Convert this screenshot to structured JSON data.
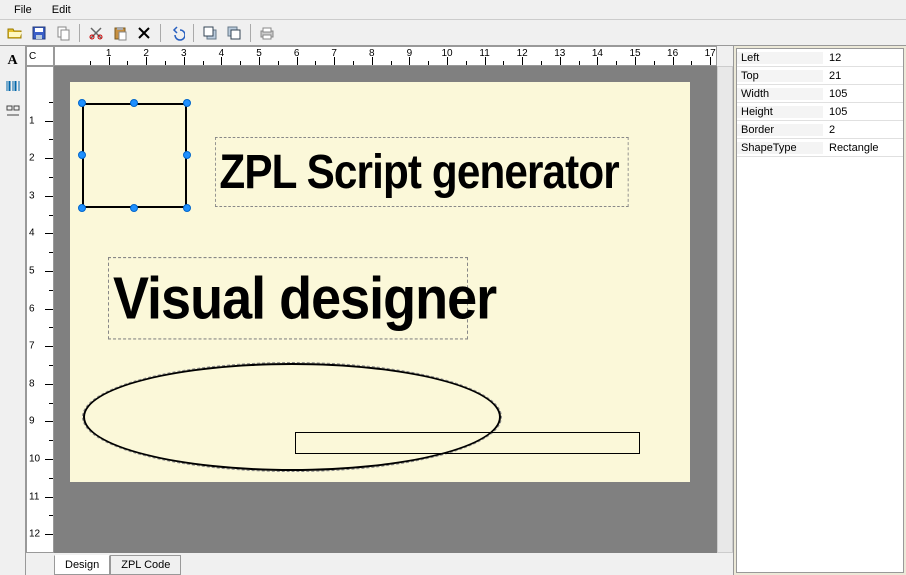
{
  "menu": {
    "file": "File",
    "edit": "Edit"
  },
  "toolbar": {
    "open": "Open",
    "save": "Save",
    "copy": "Copy",
    "cut": "Cut",
    "paste": "Paste",
    "delete": "Delete",
    "undo": "Undo",
    "bringFront": "Bring to Front",
    "sendBack": "Send to Back",
    "print": "Print"
  },
  "palette": {
    "textTool": "A",
    "barcodeTool": "Barcode",
    "otherTool": "Align"
  },
  "ruler": {
    "cornerLabel": "C",
    "hTicks": [
      1,
      2,
      3,
      4,
      5,
      6,
      7,
      8,
      9,
      10,
      11,
      12,
      13,
      14,
      15,
      16,
      17
    ],
    "vTicks": [
      1,
      2,
      3,
      4,
      5,
      6,
      7,
      8,
      9,
      10,
      11,
      12
    ]
  },
  "canvas": {
    "text1": "ZPL Script generator",
    "text2": "Visual designer"
  },
  "tabs": {
    "design": "Design",
    "zpl": "ZPL Code"
  },
  "props": [
    {
      "label": "Left",
      "value": "12"
    },
    {
      "label": "Top",
      "value": "21"
    },
    {
      "label": "Width",
      "value": "105"
    },
    {
      "label": "Height",
      "value": "105"
    },
    {
      "label": "Border",
      "value": "2"
    },
    {
      "label": "ShapeType",
      "value": "Rectangle"
    }
  ]
}
